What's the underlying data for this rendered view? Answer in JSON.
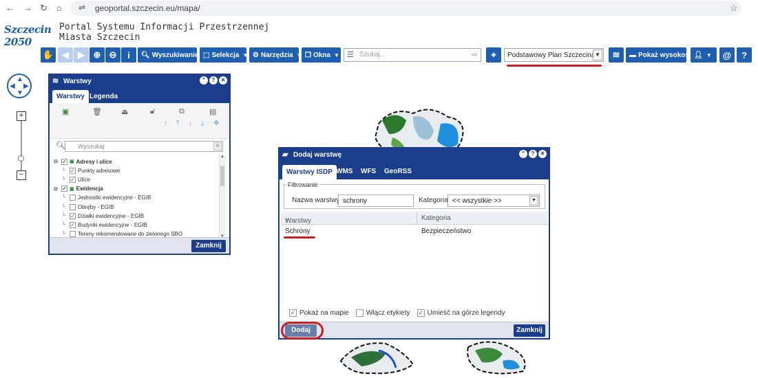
{
  "browser": {
    "url": "geoportal.szczecin.eu/mapa/",
    "back": "←",
    "forward": "→",
    "reload": "↻",
    "home": "⌂",
    "tune": "⇌",
    "bookmark": "☆"
  },
  "header": {
    "logo_text": "Szczecin 2050",
    "title_line1": "Portal Systemu Informacji Przestrzennej",
    "title_line2": "Miasta Szczecin"
  },
  "toolbar": {
    "search_label": "Wyszukiwanie",
    "selection_label": "Selekcja",
    "tools_label": "Narzędzia",
    "windows_label": "Okna",
    "search_placeholder": "Szukaj...",
    "plan_value": "Podstawowy Plan Szczecina",
    "height_label": "Pokaż wysokość",
    "help": "?",
    "at": "@",
    "info": "i"
  },
  "layers_panel": {
    "title": "Warstwy",
    "tabs": [
      "Warstwy",
      "Legenda"
    ],
    "search_placeholder": "Wyszukaj",
    "tree": [
      {
        "label": "Adresy i ulice",
        "group": true,
        "checked": true
      },
      {
        "label": "Punkty adresowe",
        "group": false,
        "checked": true
      },
      {
        "label": "Ulice",
        "group": false,
        "checked": true
      },
      {
        "label": "Ewidencja",
        "group": true,
        "checked": true
      },
      {
        "label": "Jednostki ewidencyjne - EGIB",
        "group": false,
        "checked": false
      },
      {
        "label": "Obręby - EGIB",
        "group": false,
        "checked": false
      },
      {
        "label": "Działki ewidencyjne - EGIB",
        "group": false,
        "checked": true
      },
      {
        "label": "Budynki ewidencyjne - EGIB",
        "group": false,
        "checked": true
      },
      {
        "label": "Tereny rekomendowane do zielonego SBO",
        "group": false,
        "checked": false
      }
    ],
    "close_label": "Zamknij"
  },
  "add_layer_dialog": {
    "title": "Dodaj warstwę",
    "tabs": [
      "Warstwy ISDP",
      "WMS",
      "WFS",
      "GeoRSS"
    ],
    "filter_legend": "Filtrowanie",
    "name_label": "Nazwa warstwy:",
    "name_value": "schrony",
    "category_label": "Kategoria:",
    "category_value": "<< wszystkie >>",
    "columns": [
      "Warstwy",
      "Kategoria"
    ],
    "rows": [
      {
        "layer": "Schrony",
        "category": "Bezpieczeństwo"
      }
    ],
    "options": [
      {
        "label": "Pokaż na mapie",
        "checked": true
      },
      {
        "label": "Włącz etykiety",
        "checked": false
      },
      {
        "label": "Umieść na górze legendy",
        "checked": true
      }
    ],
    "add_label": "Dodaj",
    "close_label": "Zamknij"
  },
  "colors": {
    "toolbar_blue": "#1f5fb2",
    "panel_navy": "#1a3d8c",
    "annotation_red": "#d01c1c"
  }
}
